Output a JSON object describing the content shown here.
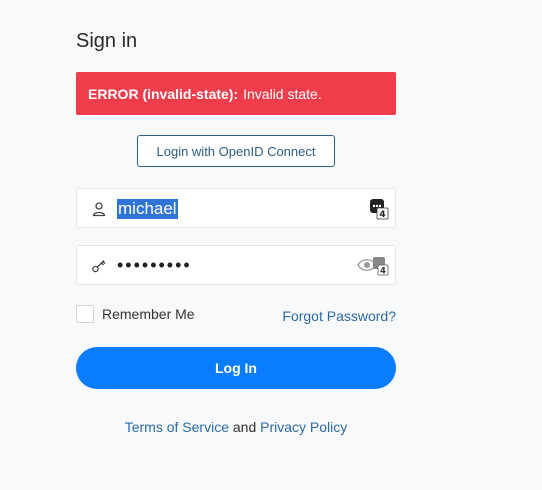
{
  "title": "Sign in",
  "error": {
    "code": "ERROR (invalid-state):",
    "message": "Invalid state.",
    "color": "#ef3d4b"
  },
  "oidc_button": "Login with OpenID Connect",
  "username": {
    "value": "michael",
    "icon": "user-icon"
  },
  "password": {
    "value": "•••••••••",
    "icon": "key-icon"
  },
  "password_manager_badge": "4",
  "remember_me": {
    "label": "Remember Me",
    "checked": false
  },
  "forgot_password": "Forgot Password?",
  "login_button": "Log In",
  "footer": {
    "terms": "Terms of Service",
    "and": "and",
    "privacy": "Privacy Policy"
  },
  "accent_color": "#0a7cff",
  "link_color": "#2c6aa5"
}
